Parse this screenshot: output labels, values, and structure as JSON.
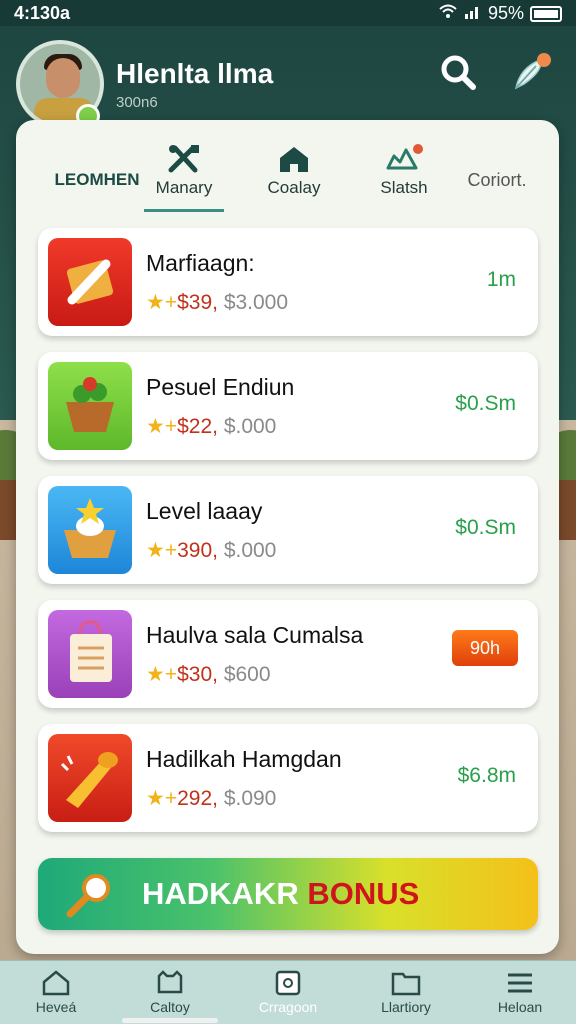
{
  "status_bar": {
    "time": "4:130a",
    "battery": "95%"
  },
  "header": {
    "title": "Hlenlta llma",
    "subtitle": "300n6"
  },
  "tabs": [
    {
      "label": "LEOMHEN",
      "icon": ""
    },
    {
      "label": "Manary",
      "icon": "tools-icon",
      "active": true
    },
    {
      "label": "Coalay",
      "icon": "house-icon"
    },
    {
      "label": "Slatsh",
      "icon": "cloud-icon"
    },
    {
      "label": "Coriort.",
      "icon": ""
    }
  ],
  "items": [
    {
      "name": "Marfiaagn:",
      "price": "$39,",
      "old_price": "$3.000",
      "value": "1m",
      "thumb_color": "#e52a20",
      "icon": "pencil-ruler-icon"
    },
    {
      "name": "Pesuel Endiun",
      "price": "$22,",
      "old_price": "$.000",
      "value": "$0.Sm",
      "thumb_color": "#7ed23a",
      "icon": "plant-basket-icon"
    },
    {
      "name": "Level laaay",
      "price": "390,",
      "old_price": "$.000",
      "value": "$0.Sm",
      "thumb_color": "#2e9ae8",
      "icon": "egg-basket-icon"
    },
    {
      "name": "Haulva sala Cumalsa",
      "price": "$30,",
      "old_price": "$600",
      "value": "90h",
      "pill": true,
      "thumb_color": "#b05ac8",
      "icon": "shopping-bag-icon"
    },
    {
      "name": "Hadilkah Hamgdan",
      "price": "292,",
      "old_price": "$.090",
      "value": "$6.8m",
      "thumb_color": "#e8341e",
      "icon": "trumpet-icon"
    }
  ],
  "bonus": {
    "word1": "HADKAKR",
    "word2": "BONUS"
  },
  "nav": [
    {
      "label": "Heveá",
      "icon": "home-icon"
    },
    {
      "label": "Caltoy",
      "icon": "cat-icon"
    },
    {
      "label": "Crragoon",
      "icon": "square-icon",
      "active": true
    },
    {
      "label": "Llartiory",
      "icon": "folder-icon"
    },
    {
      "label": "Heloan",
      "icon": "menu-icon"
    }
  ],
  "colors": {
    "accent": "#3b8e86",
    "price_red": "#c0321c",
    "value_green": "#2aa04a",
    "panel": "#f2f6ee"
  }
}
